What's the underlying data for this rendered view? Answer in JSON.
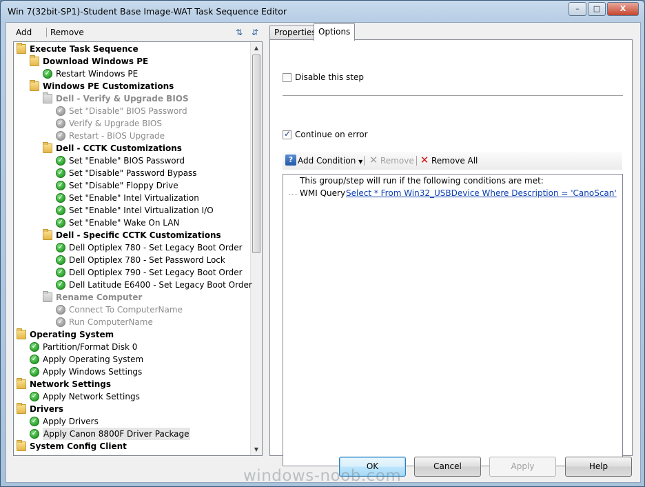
{
  "window": {
    "title": "Win 7(32bit-SP1)-Student Base Image-WAT Task Sequence Editor",
    "minimize": "–",
    "maximize": "□",
    "close": "X"
  },
  "toolbar": {
    "add_label": "Add",
    "remove_label": "Remove"
  },
  "tree": [
    {
      "label": "Execute Task Sequence",
      "type": "folder",
      "level": 0,
      "bold": true,
      "disabled": false
    },
    {
      "label": "Download Windows PE",
      "type": "folder",
      "level": 1,
      "bold": true,
      "disabled": false
    },
    {
      "label": "Restart Windows PE",
      "type": "check",
      "level": 2,
      "bold": false,
      "disabled": false
    },
    {
      "label": "Windows PE Customizations",
      "type": "folder",
      "level": 1,
      "bold": true,
      "disabled": false
    },
    {
      "label": "Dell - Verify & Upgrade BIOS",
      "type": "folder",
      "level": 2,
      "bold": true,
      "disabled": true
    },
    {
      "label": "Set \"Disable\" BIOS Password",
      "type": "check",
      "level": 3,
      "bold": false,
      "disabled": true
    },
    {
      "label": "Verify & Upgrade BIOS",
      "type": "check",
      "level": 3,
      "bold": false,
      "disabled": true
    },
    {
      "label": "Restart - BIOS Upgrade",
      "type": "check",
      "level": 3,
      "bold": false,
      "disabled": true
    },
    {
      "label": "Dell - CCTK Customizations",
      "type": "folder",
      "level": 2,
      "bold": true,
      "disabled": false
    },
    {
      "label": "Set \"Enable\" BIOS Password",
      "type": "check",
      "level": 3,
      "bold": false,
      "disabled": false
    },
    {
      "label": "Set \"Disable\" Password Bypass",
      "type": "check",
      "level": 3,
      "bold": false,
      "disabled": false
    },
    {
      "label": "Set \"Disable\" Floppy Drive",
      "type": "check",
      "level": 3,
      "bold": false,
      "disabled": false
    },
    {
      "label": "Set \"Enable\" Intel Virtualization",
      "type": "check",
      "level": 3,
      "bold": false,
      "disabled": false
    },
    {
      "label": "Set \"Enable\" Intel Virtualization I/O",
      "type": "check",
      "level": 3,
      "bold": false,
      "disabled": false
    },
    {
      "label": "Set \"Enable\" Wake On LAN",
      "type": "check",
      "level": 3,
      "bold": false,
      "disabled": false
    },
    {
      "label": "Dell  - Specific CCTK Customizations",
      "type": "folder",
      "level": 2,
      "bold": true,
      "disabled": false
    },
    {
      "label": "Dell Optiplex 780 - Set Legacy Boot Order",
      "type": "check",
      "level": 3,
      "bold": false,
      "disabled": false
    },
    {
      "label": "Dell Optiplex 780 - Set Password Lock",
      "type": "check",
      "level": 3,
      "bold": false,
      "disabled": false
    },
    {
      "label": "Dell Optiplex 790 - Set Legacy Boot Order",
      "type": "check",
      "level": 3,
      "bold": false,
      "disabled": false
    },
    {
      "label": "Dell Latitude E6400 - Set Legacy Boot Order",
      "type": "check",
      "level": 3,
      "bold": false,
      "disabled": false
    },
    {
      "label": "Rename Computer",
      "type": "folder",
      "level": 2,
      "bold": true,
      "disabled": true
    },
    {
      "label": "Connect To ComputerName",
      "type": "check",
      "level": 3,
      "bold": false,
      "disabled": true
    },
    {
      "label": "Run ComputerName",
      "type": "check",
      "level": 3,
      "bold": false,
      "disabled": true
    },
    {
      "label": "Operating System",
      "type": "folder",
      "level": 0,
      "bold": true,
      "disabled": false
    },
    {
      "label": "Partition/Format Disk 0",
      "type": "check",
      "level": 1,
      "bold": false,
      "disabled": false
    },
    {
      "label": "Apply Operating System",
      "type": "check",
      "level": 1,
      "bold": false,
      "disabled": false
    },
    {
      "label": "Apply Windows Settings",
      "type": "check",
      "level": 1,
      "bold": false,
      "disabled": false
    },
    {
      "label": "Network Settings",
      "type": "folder",
      "level": 0,
      "bold": true,
      "disabled": false
    },
    {
      "label": "Apply Network Settings",
      "type": "check",
      "level": 1,
      "bold": false,
      "disabled": false
    },
    {
      "label": "Drivers",
      "type": "folder",
      "level": 0,
      "bold": true,
      "disabled": false
    },
    {
      "label": "Apply Drivers",
      "type": "check",
      "level": 1,
      "bold": false,
      "disabled": false
    },
    {
      "label": "Apply Canon 8800F Driver Package",
      "type": "check",
      "level": 1,
      "bold": false,
      "disabled": false,
      "selected": true
    },
    {
      "label": "System Config Client",
      "type": "folder",
      "level": 0,
      "bold": true,
      "disabled": false
    }
  ],
  "tabs": {
    "properties": "Properties",
    "options": "Options"
  },
  "options": {
    "disable_step_label": "Disable this step",
    "disable_step_checked": false,
    "continue_on_error_label": "Continue on error",
    "continue_on_error_checked": true,
    "add_condition_label": "Add Condition",
    "remove_label": "Remove",
    "remove_all_label": "Remove All",
    "conditions_header": "This group/step will run if the following conditions are met:",
    "condition_type": "WMI Query",
    "condition_query": "Select * From Win32_USBDevice Where Description = 'CanoScan'"
  },
  "buttons": {
    "ok": "OK",
    "cancel": "Cancel",
    "apply": "Apply",
    "help": "Help"
  },
  "watermark": "windows-noob.com",
  "colors": {
    "titlebar": "#b7cde4",
    "check_green": "#2aa12a",
    "folder_yellow": "#e6b64a",
    "link_blue": "#0b3fb0",
    "remove_red": "#d01818"
  }
}
